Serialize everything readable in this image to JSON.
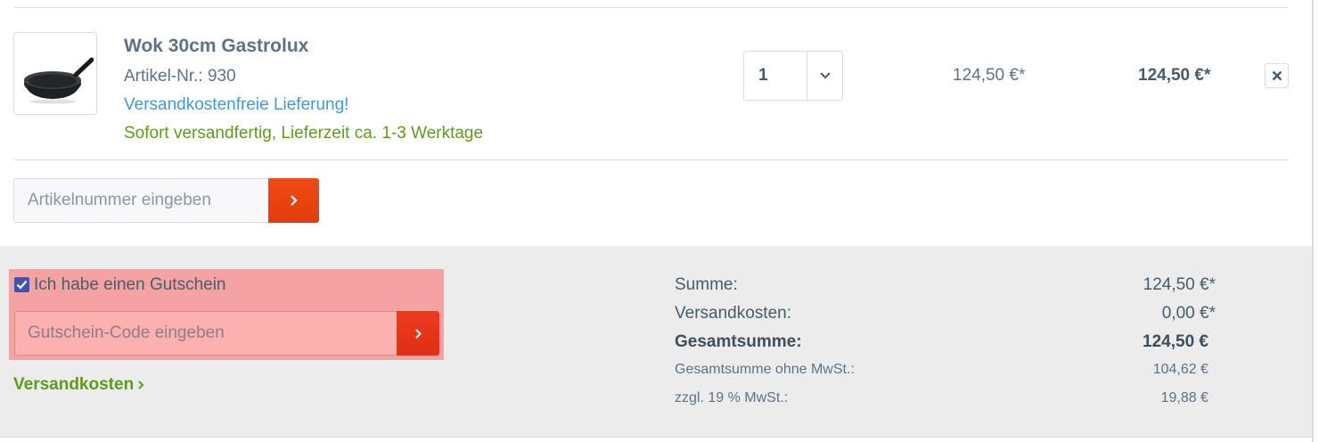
{
  "product": {
    "name": "Wok 30cm Gastrolux",
    "article_number": "Artikel-Nr.: 930",
    "shipping_note": "Versandkostenfreie Lieferung!",
    "delivery_note": "Sofort versandfertig, Lieferzeit ca. 1-3 Werktage",
    "quantity": "1",
    "unit_price": "124,50 €*",
    "total_price": "124,50 €*"
  },
  "add_article": {
    "placeholder": "Artikelnummer eingeben"
  },
  "voucher": {
    "checked": true,
    "checkbox_label": "Ich habe einen Gutschein",
    "placeholder": "Gutschein-Code eingeben"
  },
  "shipping_link": "Versandkosten",
  "summary": {
    "subtotal_label": "Summe:",
    "subtotal_value": "124,50 €*",
    "shipping_label": "Versandkosten:",
    "shipping_value": "0,00 €*",
    "total_label": "Gesamtsumme:",
    "total_value": "124,50 €",
    "net_label": "Gesamtsumme ohne MwSt.:",
    "net_value": "104,62 €",
    "vat_label": "zzgl. 19 % MwSt.:",
    "vat_value": "19,88 €"
  },
  "colors": {
    "accent_button": "#e33c08",
    "link_green": "#5f9a1b",
    "link_blue": "#3e9bd8",
    "highlight": "#f4a2a2"
  }
}
